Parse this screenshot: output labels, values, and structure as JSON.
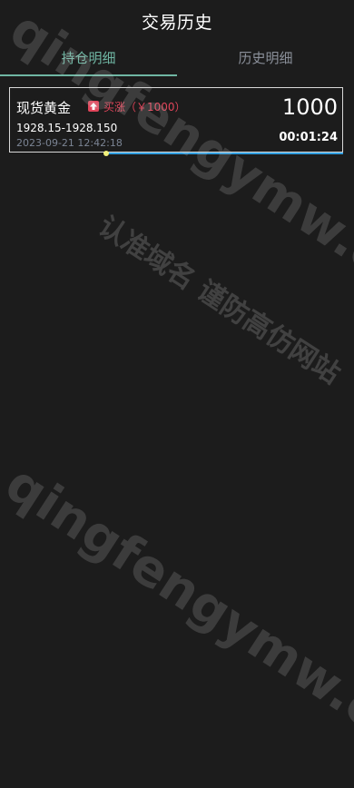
{
  "header": {
    "title": "交易历史"
  },
  "tabs": [
    {
      "label": "持仓明细",
      "active": true
    },
    {
      "label": "历史明细",
      "active": false
    }
  ],
  "position": {
    "name": "现货黄金",
    "direction_icon": "arrow-up-icon",
    "direction": "买涨（￥1000）",
    "price_range": "1928.15-1928.150",
    "time": "2023-09-21 12:42:18",
    "amount": "1000",
    "countdown": "00:01:24",
    "progress": 0.29
  },
  "watermark": {
    "site": "qingfengymw.com",
    "slogan": "认准域名 谨防高仿网站"
  },
  "colors": {
    "background": "#1c1c1c",
    "accent_tab": "#6fb6a3",
    "up_red": "#e0455a",
    "progress_blue": "#2f9ee0",
    "progress_dot": "#f1f07a"
  }
}
